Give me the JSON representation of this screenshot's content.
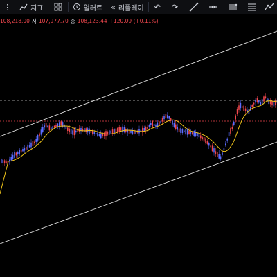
{
  "toolbar": {
    "indicators_label": "지표",
    "alerts_label": "얼러트",
    "replay_label": "리플레이",
    "icons": [
      "layout-icon",
      "indicators-icon",
      "templates-icon",
      "alert-icon",
      "replay-icon",
      "undo-icon",
      "redo-icon",
      "trendline-icon",
      "horizontal-line-icon",
      "parallel-channel-icon",
      "multi-line-icon",
      "path-icon"
    ]
  },
  "ohlc": {
    "open_partial": "108,218.00",
    "low_label": "저",
    "low_value": "107,977.70",
    "close_label": "종",
    "close_value": "108,123.44",
    "change": "+120.09 (+0.11%)"
  },
  "colors": {
    "background": "#000000",
    "up_candle": "#f0474d",
    "down_candle": "#5b6cff",
    "ma_line": "#f0c419",
    "channel_line": "#e0e0e0",
    "dashed_gray": "#c8c8c8",
    "dashed_red": "#f0474d"
  }
}
